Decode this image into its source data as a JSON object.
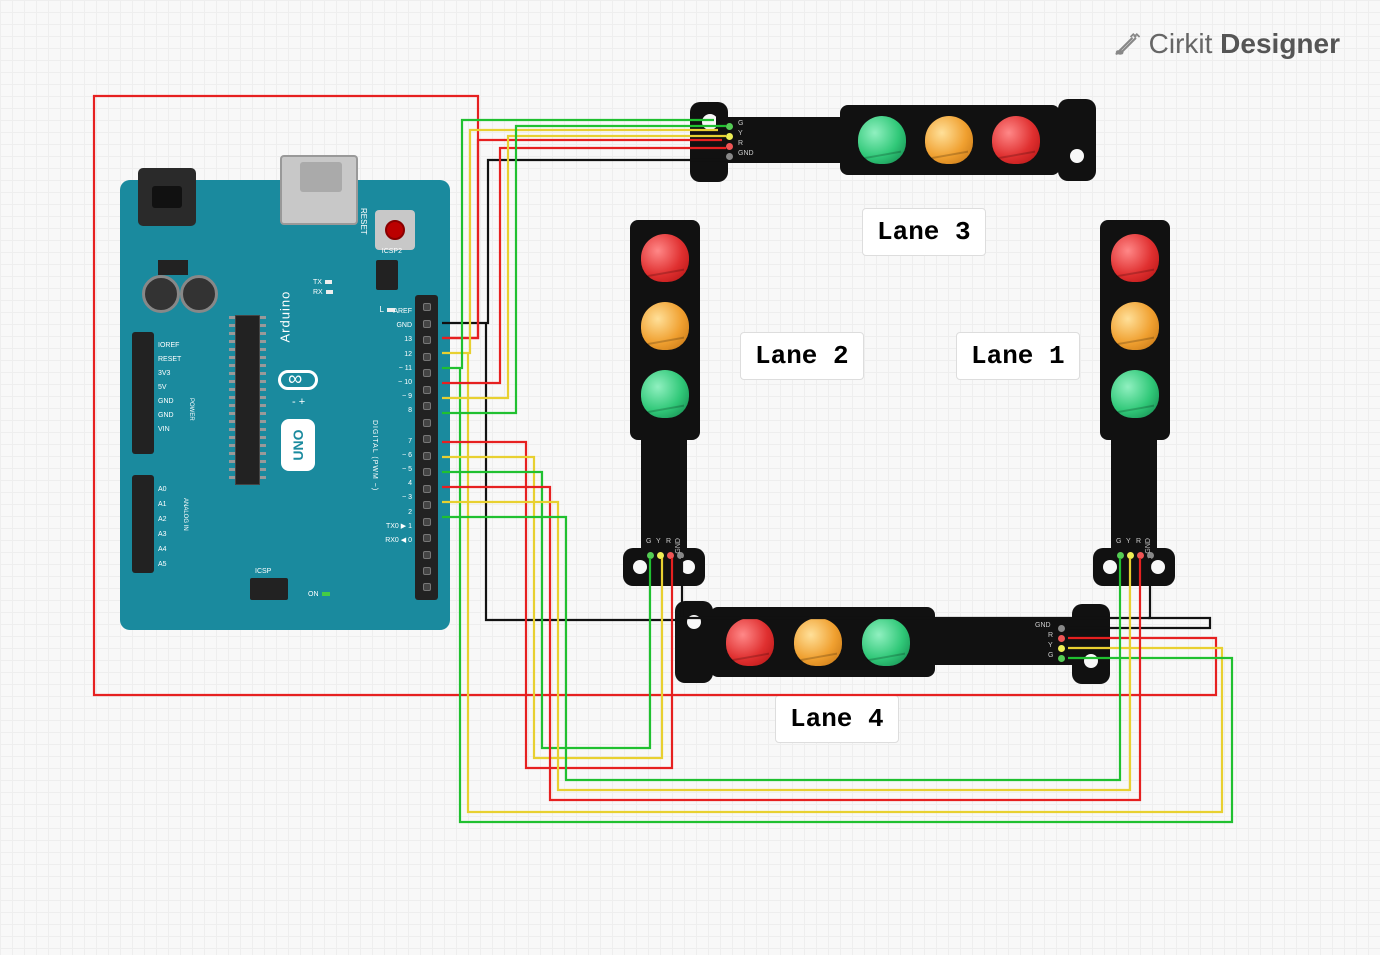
{
  "app": {
    "brand_a": "Cirkit",
    "brand_b": "Designer"
  },
  "labels": {
    "lane1": "Lane 1",
    "lane2": "Lane 2",
    "lane3": "Lane 3",
    "lane4": "Lane 4"
  },
  "arduino": {
    "name": "Arduino",
    "model": "UNO",
    "reset": "RESET",
    "icsp2": "ICSP2",
    "icsp": "ICSP",
    "on": "ON",
    "tx": "TX",
    "rx": "RX",
    "l": "L",
    "aref": "AREF",
    "gnd": "GND",
    "dpwm": "DIGITAL (PWM ~)",
    "tx0": "TX0 ▶ 1",
    "rx0": "RX0 ◀ 0",
    "power_lbl": "POWER",
    "analog_lbl": "ANALOG IN",
    "left_pins1": "IOREF\nRESET\n3V3\n5V\nGND\nGND\nVIN",
    "left_pins2": "A0\nA1\nA2\nA3\nA4\nA5",
    "digital_pins": [
      "13",
      "12",
      "~ 11",
      "~ 10",
      "~ 9",
      "8",
      "7",
      "~ 6",
      "~ 5",
      "4",
      "~ 3",
      "2"
    ]
  },
  "module_pins": {
    "g": "G",
    "y": "Y",
    "r": "R",
    "gnd": "GND"
  },
  "circuit": {
    "board": "Arduino UNO",
    "components": [
      {
        "id": "lane1",
        "type": "traffic-light-led-module",
        "orientation": "vertical",
        "led_order_top_to_bottom": [
          "red",
          "yellow",
          "green"
        ]
      },
      {
        "id": "lane2",
        "type": "traffic-light-led-module",
        "orientation": "vertical",
        "led_order_top_to_bottom": [
          "red",
          "yellow",
          "green"
        ]
      },
      {
        "id": "lane3",
        "type": "traffic-light-led-module",
        "orientation": "horizontal",
        "led_order_left_to_right": [
          "green",
          "yellow",
          "red"
        ]
      },
      {
        "id": "lane4",
        "type": "traffic-light-led-module",
        "orientation": "horizontal",
        "led_order_left_to_right": [
          "red",
          "yellow",
          "green"
        ]
      }
    ],
    "connections": [
      {
        "from": "D2",
        "to": "lane1.G",
        "color": "green"
      },
      {
        "from": "D3",
        "to": "lane1.Y",
        "color": "yellow"
      },
      {
        "from": "D4",
        "to": "lane1.R",
        "color": "red"
      },
      {
        "from": "D5",
        "to": "lane2.G",
        "color": "green"
      },
      {
        "from": "D6",
        "to": "lane2.Y",
        "color": "yellow"
      },
      {
        "from": "D7",
        "to": "lane2.R",
        "color": "red"
      },
      {
        "from": "D8",
        "to": "lane3.G",
        "color": "green"
      },
      {
        "from": "D9",
        "to": "lane3.Y",
        "color": "yellow"
      },
      {
        "from": "D10",
        "to": "lane3.R",
        "color": "red"
      },
      {
        "from": "D11",
        "to": "lane4.G",
        "color": "green"
      },
      {
        "from": "D12",
        "to": "lane4.Y",
        "color": "yellow"
      },
      {
        "from": "D13",
        "to": "lane4.R",
        "color": "red"
      },
      {
        "from": "GND",
        "to": "lane1.GND,lane2.GND,lane3.GND,lane4.GND",
        "color": "black"
      }
    ]
  }
}
